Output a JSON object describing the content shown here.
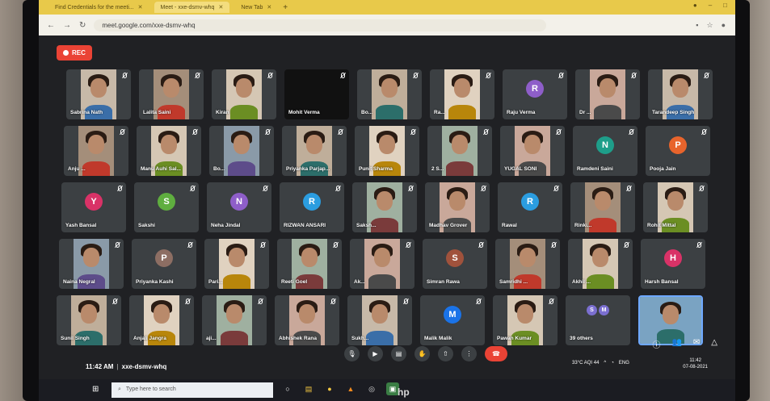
{
  "browser": {
    "tabs": [
      {
        "label": "Find Credentials for the meeti...",
        "active": false
      },
      {
        "label": "Meet - xxe-dsmv-whq",
        "active": true
      },
      {
        "label": "New Tab",
        "active": false
      }
    ],
    "url": "meet.google.com/xxe-dsmv-whq"
  },
  "meet": {
    "rec_label": "REC",
    "meeting_time": "11:42 AM",
    "meeting_code": "xxe-dsmv-whq",
    "participants": [
      {
        "name": "Sabrina Nath",
        "type": "photo"
      },
      {
        "name": "Lalita Saini",
        "type": "photo"
      },
      {
        "name": "Kiran",
        "type": "photo"
      },
      {
        "name": "Mohit Verma",
        "type": "dark"
      },
      {
        "name": "Bo...",
        "type": "photo"
      },
      {
        "name": "Ra...",
        "type": "photo"
      },
      {
        "name": "Raju Verma",
        "type": "avatar",
        "initial": "R",
        "color": "#8e5ec9"
      },
      {
        "name": "Dr ...",
        "type": "photo"
      },
      {
        "name": "Tarandeep Singh",
        "type": "photo"
      },
      {
        "name": "Anju ...",
        "type": "photo"
      },
      {
        "name": "Manu Auhi Sal...",
        "type": "photo"
      },
      {
        "name": "Bo...",
        "type": "photo"
      },
      {
        "name": "Priyanka Parjap...",
        "type": "photo"
      },
      {
        "name": "Punit Sharma",
        "type": "photo"
      },
      {
        "name": "2 S...",
        "type": "photo"
      },
      {
        "name": "YUGAL SONI",
        "type": "photo"
      },
      {
        "name": "Ramdeni Saini",
        "type": "avatar",
        "initial": "N",
        "color": "#1e9e8a"
      },
      {
        "name": "Pooja Jain",
        "type": "avatar",
        "initial": "P",
        "color": "#e8642c"
      },
      {
        "name": "Yash Bansal",
        "type": "avatar",
        "initial": "Y",
        "color": "#d93267"
      },
      {
        "name": "Sakshi",
        "type": "avatar",
        "initial": "S",
        "color": "#5fae3f"
      },
      {
        "name": "Neha Jindal",
        "type": "avatar",
        "initial": "N",
        "color": "#8e5ec9"
      },
      {
        "name": "RIZWAN ANSARI",
        "type": "avatar",
        "initial": "R",
        "color": "#2b9de0"
      },
      {
        "name": "Saksh...",
        "type": "photo"
      },
      {
        "name": "Madhav Grover",
        "type": "photo"
      },
      {
        "name": "Rawal",
        "type": "avatar",
        "initial": "R",
        "color": "#2b9de0"
      },
      {
        "name": "Rinki...",
        "type": "photo"
      },
      {
        "name": "Rohit Mittal",
        "type": "photo"
      },
      {
        "name": "Naina Negral",
        "type": "photo"
      },
      {
        "name": "Priyanka Kashi",
        "type": "avatar",
        "initial": "P",
        "color": "#8d6e63"
      },
      {
        "name": "Pari...",
        "type": "photo"
      },
      {
        "name": "Reeti Goel",
        "type": "photo"
      },
      {
        "name": "Ak...",
        "type": "photo"
      },
      {
        "name": "Simran Rawa",
        "type": "avatar",
        "initial": "S",
        "color": "#a0523c"
      },
      {
        "name": "Samridhi ...",
        "type": "photo"
      },
      {
        "name": "Akhil ...",
        "type": "photo"
      },
      {
        "name": "Harsh Bansal",
        "type": "avatar",
        "initial": "H",
        "color": "#d93267"
      },
      {
        "name": "Sunil Singh",
        "type": "photo"
      },
      {
        "name": "Anjali Jangra",
        "type": "photo"
      },
      {
        "name": "aji...",
        "type": "photo"
      },
      {
        "name": "Abhishek Rana",
        "type": "photo"
      },
      {
        "name": "Sukh...",
        "type": "photo"
      },
      {
        "name": "Malik Malik",
        "type": "avatar",
        "initial": "M",
        "color": "#1a73e8"
      },
      {
        "name": "Pawan Kumar",
        "type": "photo"
      },
      {
        "name": "39 others",
        "type": "others",
        "initials": [
          "S",
          "M"
        ]
      },
      {
        "name": "",
        "type": "self"
      }
    ],
    "controls": [
      "mic",
      "camera",
      "captions",
      "raise-hand",
      "present",
      "more",
      "end-call"
    ],
    "right_controls": [
      "info",
      "people",
      "chat",
      "activities"
    ]
  },
  "taskbar": {
    "search_placeholder": "Type here to search",
    "tray_text": "33°C AQI 44",
    "tray_lang": "ENG",
    "time": "11:42",
    "date": "07-08-2021"
  },
  "colors": {
    "tab_bar": "#e8c94a",
    "meet_bg": "#202124",
    "tile_bg": "#3c4043",
    "end_call": "#ea4335"
  }
}
